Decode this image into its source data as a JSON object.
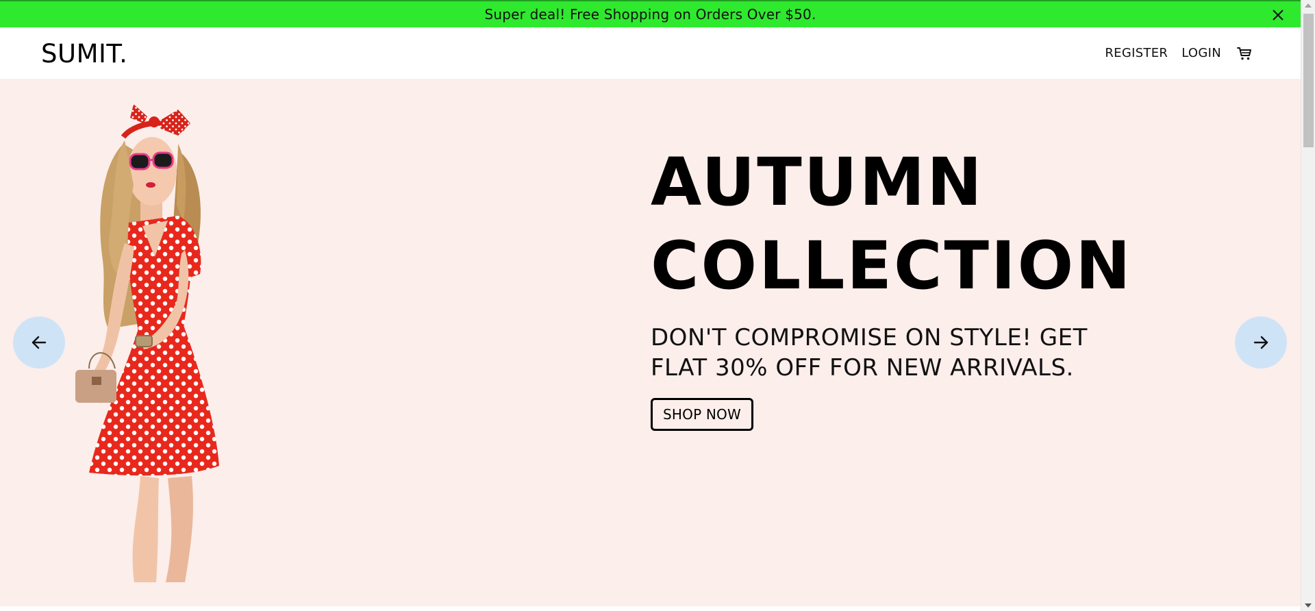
{
  "announcement": {
    "text": "Super deal! Free Shopping on Orders Over $50.",
    "close_icon": "close-icon",
    "background": "#2fe92f"
  },
  "navbar": {
    "logo": "SUMIT.",
    "links": [
      {
        "label": "REGISTER"
      },
      {
        "label": "LOGIN"
      }
    ],
    "cart_icon": "shopping-cart-icon"
  },
  "hero": {
    "background": "#fbeeeb",
    "title_line1": "AUTUMN",
    "title_line2": "COLLECTION",
    "subtitle": "DON'T COMPROMISE ON STYLE! GET FLAT 30% OFF FOR NEW ARRIVALS.",
    "cta_label": "SHOP NOW",
    "prev_icon": "arrow-left-icon",
    "next_icon": "arrow-right-icon",
    "arrow_bg": "#cfe3f7",
    "image": "model-in-red-polka-dot-dress"
  }
}
